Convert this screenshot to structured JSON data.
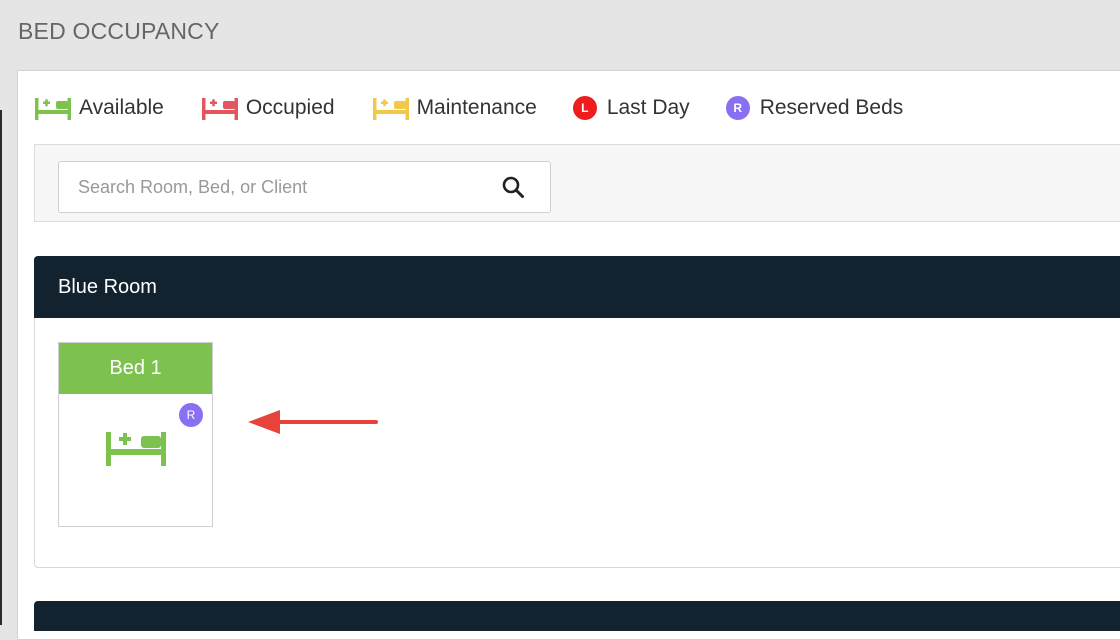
{
  "page": {
    "title": "BED OCCUPANCY"
  },
  "legend": [
    {
      "label": "Available",
      "icon": "bed-icon",
      "color": "#7dc24f"
    },
    {
      "label": "Occupied",
      "icon": "bed-icon",
      "color": "#e2575f"
    },
    {
      "label": "Maintenance",
      "icon": "bed-icon",
      "color": "#f2c84b"
    },
    {
      "label": "Last Day",
      "badge": "L",
      "color": "#ee1c1c"
    },
    {
      "label": "Reserved Beds",
      "badge": "R",
      "color": "#8b6ff2"
    }
  ],
  "search": {
    "placeholder": "Search Room, Bed, or Client",
    "value": ""
  },
  "rooms": [
    {
      "name": "Blue Room",
      "beds": [
        {
          "label": "Bed 1",
          "status": "Available",
          "badge": "R",
          "color": "#7dc24f"
        }
      ]
    }
  ],
  "colors": {
    "room_header": "#12232f",
    "annotation_arrow": "#e8433a"
  }
}
